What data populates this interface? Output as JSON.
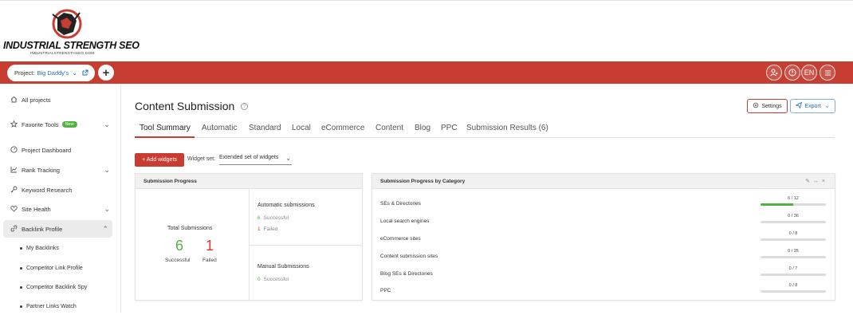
{
  "logo": {
    "title": "INDUSTRIAL STRENGTH SEO",
    "subtitle": "INDUSTRIALSTRENGTHSEO.COM"
  },
  "colors": {
    "brand_red": "#c73d31",
    "success_green": "#52b142",
    "failed_red": "#d9392c",
    "link_blue": "#2b6fb6"
  },
  "topbar": {
    "project_label": "Project:",
    "project_name": "Big Daddy's",
    "icons": [
      "add-icon",
      "user-icon",
      "help-icon",
      "menu-icon"
    ],
    "language": "EN"
  },
  "sidebar": {
    "items": [
      {
        "label": "All projects",
        "icon": "home-icon"
      },
      {
        "label": "Favorite Tools",
        "icon": "star-icon",
        "badge": "New"
      },
      {
        "label": "Project Dashboard",
        "icon": "dashboard-icon"
      },
      {
        "label": "Rank Tracking",
        "icon": "chart-icon"
      },
      {
        "label": "Keyword Research",
        "icon": "key-icon"
      },
      {
        "label": "Site Health",
        "icon": "heart-icon"
      },
      {
        "label": "Backlink Profile",
        "icon": "link-icon"
      }
    ],
    "subitems": [
      "My Backlinks",
      "Competitor Link Profile",
      "Competitor Backlink Spy",
      "Partner Links Watch"
    ]
  },
  "main": {
    "title": "Content Submission",
    "settings_label": "Settings",
    "export_label": "Export",
    "tabs": [
      "Tool Summary",
      "Automatic",
      "Standard",
      "Local",
      "eCommerce",
      "Content",
      "Blog",
      "PPC",
      "Submission Results (6)"
    ],
    "active_tab": "Tool Summary",
    "add_widgets_label": "+ Add widgets",
    "widget_set_label": "Widget set:",
    "widget_set_value": "Extended set of widgets"
  },
  "progress_panel": {
    "title": "Submission Progress",
    "total_label": "Total Submissions",
    "successful_count": "6",
    "successful_label": "Successful",
    "failed_count": "1",
    "failed_label": "Failed",
    "automatic_title": "Automatic submissions",
    "automatic_successful": "6",
    "automatic_successful_label": "Successful",
    "automatic_failed": "1",
    "automatic_failed_label": "Failed",
    "manual_title": "Manual Submissions",
    "manual_successful": "0",
    "manual_successful_label": "Successful"
  },
  "category_panel": {
    "title": "Submission Progress by Category",
    "rows": [
      {
        "label": "SEs & Directories",
        "count": "6 / 12",
        "fraction": 0.5
      },
      {
        "label": "Local search engines",
        "count": "0 / 36",
        "fraction": 0
      },
      {
        "label": "eCommerce sites",
        "count": "0 / 8",
        "fraction": 0
      },
      {
        "label": "Content submission sites",
        "count": "0 / 25",
        "fraction": 0
      },
      {
        "label": "Blog SEs & Directories",
        "count": "0 / 7",
        "fraction": 0
      },
      {
        "label": "PPC",
        "count": "0 / 8",
        "fraction": 0
      }
    ]
  }
}
